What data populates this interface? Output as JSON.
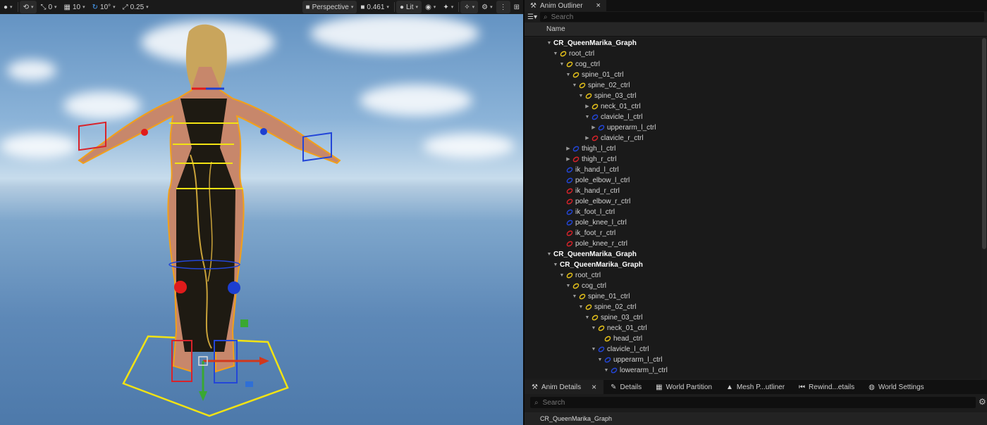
{
  "viewport_toolbar": {
    "translate_snap": "0",
    "grid_snap": "10",
    "rotate_snap": "10°",
    "scale_snap": "0.25",
    "view_mode": "Perspective",
    "camera_speed": "0.461",
    "lighting": "Lit"
  },
  "outliner": {
    "tab_label": "Anim Outliner",
    "search_placeholder": "Search",
    "column_name": "Name",
    "rows": [
      {
        "label": "CR_QueenMarika_Graph",
        "depth": 0,
        "arrow": "open",
        "ctl": "none",
        "bold": true
      },
      {
        "label": "root_ctrl",
        "depth": 1,
        "arrow": "open",
        "ctl": "yellow"
      },
      {
        "label": "cog_ctrl",
        "depth": 2,
        "arrow": "open",
        "ctl": "yellow"
      },
      {
        "label": "spine_01_ctrl",
        "depth": 3,
        "arrow": "open",
        "ctl": "yellow"
      },
      {
        "label": "spine_02_ctrl",
        "depth": 4,
        "arrow": "open",
        "ctl": "yellow"
      },
      {
        "label": "spine_03_ctrl",
        "depth": 5,
        "arrow": "open",
        "ctl": "yellow"
      },
      {
        "label": "neck_01_ctrl",
        "depth": 6,
        "arrow": "closed",
        "ctl": "yellow"
      },
      {
        "label": "clavicle_l_ctrl",
        "depth": 6,
        "arrow": "open",
        "ctl": "blue"
      },
      {
        "label": "upperarm_l_ctrl",
        "depth": 7,
        "arrow": "closed",
        "ctl": "blue"
      },
      {
        "label": "clavicle_r_ctrl",
        "depth": 6,
        "arrow": "closed",
        "ctl": "red"
      },
      {
        "label": "thigh_l_ctrl",
        "depth": 3,
        "arrow": "closed",
        "ctl": "blue"
      },
      {
        "label": "thigh_r_ctrl",
        "depth": 3,
        "arrow": "closed",
        "ctl": "red"
      },
      {
        "label": "ik_hand_l_ctrl",
        "depth": 2,
        "arrow": "none",
        "ctl": "blue"
      },
      {
        "label": "pole_elbow_l_ctrl",
        "depth": 2,
        "arrow": "none",
        "ctl": "blue"
      },
      {
        "label": "ik_hand_r_ctrl",
        "depth": 2,
        "arrow": "none",
        "ctl": "red"
      },
      {
        "label": "pole_elbow_r_ctrl",
        "depth": 2,
        "arrow": "none",
        "ctl": "red"
      },
      {
        "label": "ik_foot_l_ctrl",
        "depth": 2,
        "arrow": "none",
        "ctl": "blue"
      },
      {
        "label": "pole_knee_l_ctrl",
        "depth": 2,
        "arrow": "none",
        "ctl": "blue"
      },
      {
        "label": "ik_foot_r_ctrl",
        "depth": 2,
        "arrow": "none",
        "ctl": "red"
      },
      {
        "label": "pole_knee_r_ctrl",
        "depth": 2,
        "arrow": "none",
        "ctl": "red"
      },
      {
        "label": "CR_QueenMarika_Graph",
        "depth": 0,
        "arrow": "open",
        "ctl": "none",
        "bold": true
      },
      {
        "label": "CR_QueenMarika_Graph",
        "depth": 1,
        "arrow": "open",
        "ctl": "none",
        "bold": true
      },
      {
        "label": "root_ctrl",
        "depth": 2,
        "arrow": "open",
        "ctl": "yellow"
      },
      {
        "label": "cog_ctrl",
        "depth": 3,
        "arrow": "open",
        "ctl": "yellow"
      },
      {
        "label": "spine_01_ctrl",
        "depth": 4,
        "arrow": "open",
        "ctl": "yellow"
      },
      {
        "label": "spine_02_ctrl",
        "depth": 5,
        "arrow": "open",
        "ctl": "yellow"
      },
      {
        "label": "spine_03_ctrl",
        "depth": 6,
        "arrow": "open",
        "ctl": "yellow"
      },
      {
        "label": "neck_01_ctrl",
        "depth": 7,
        "arrow": "open",
        "ctl": "yellow"
      },
      {
        "label": "head_ctrl",
        "depth": 8,
        "arrow": "none",
        "ctl": "yellow"
      },
      {
        "label": "clavicle_l_ctrl",
        "depth": 7,
        "arrow": "open",
        "ctl": "blue"
      },
      {
        "label": "upperarm_l_ctrl",
        "depth": 8,
        "arrow": "open",
        "ctl": "blue"
      },
      {
        "label": "lowerarm_l_ctrl",
        "depth": 9,
        "arrow": "open",
        "ctl": "blue"
      }
    ]
  },
  "lower_tabs": [
    {
      "label": "Anim Details",
      "icon": "tool-icon",
      "active": true,
      "closable": true
    },
    {
      "label": "Details",
      "icon": "pencil-icon",
      "active": false
    },
    {
      "label": "World Partition",
      "icon": "grid-icon",
      "active": false
    },
    {
      "label": "Mesh P...utliner",
      "icon": "mesh-icon",
      "active": false
    },
    {
      "label": "Rewind...etails",
      "icon": "rewind-icon",
      "active": false
    },
    {
      "label": "World Settings",
      "icon": "globe-icon",
      "active": false
    }
  ],
  "details": {
    "search_placeholder": "Search",
    "selected_name": "CR_QueenMarika_Graph"
  },
  "colors": {
    "ctl_yellow": "#e6c21a",
    "ctl_blue": "#2346d8",
    "ctl_red": "#d8232a",
    "selection_orange": "#f2a019"
  }
}
